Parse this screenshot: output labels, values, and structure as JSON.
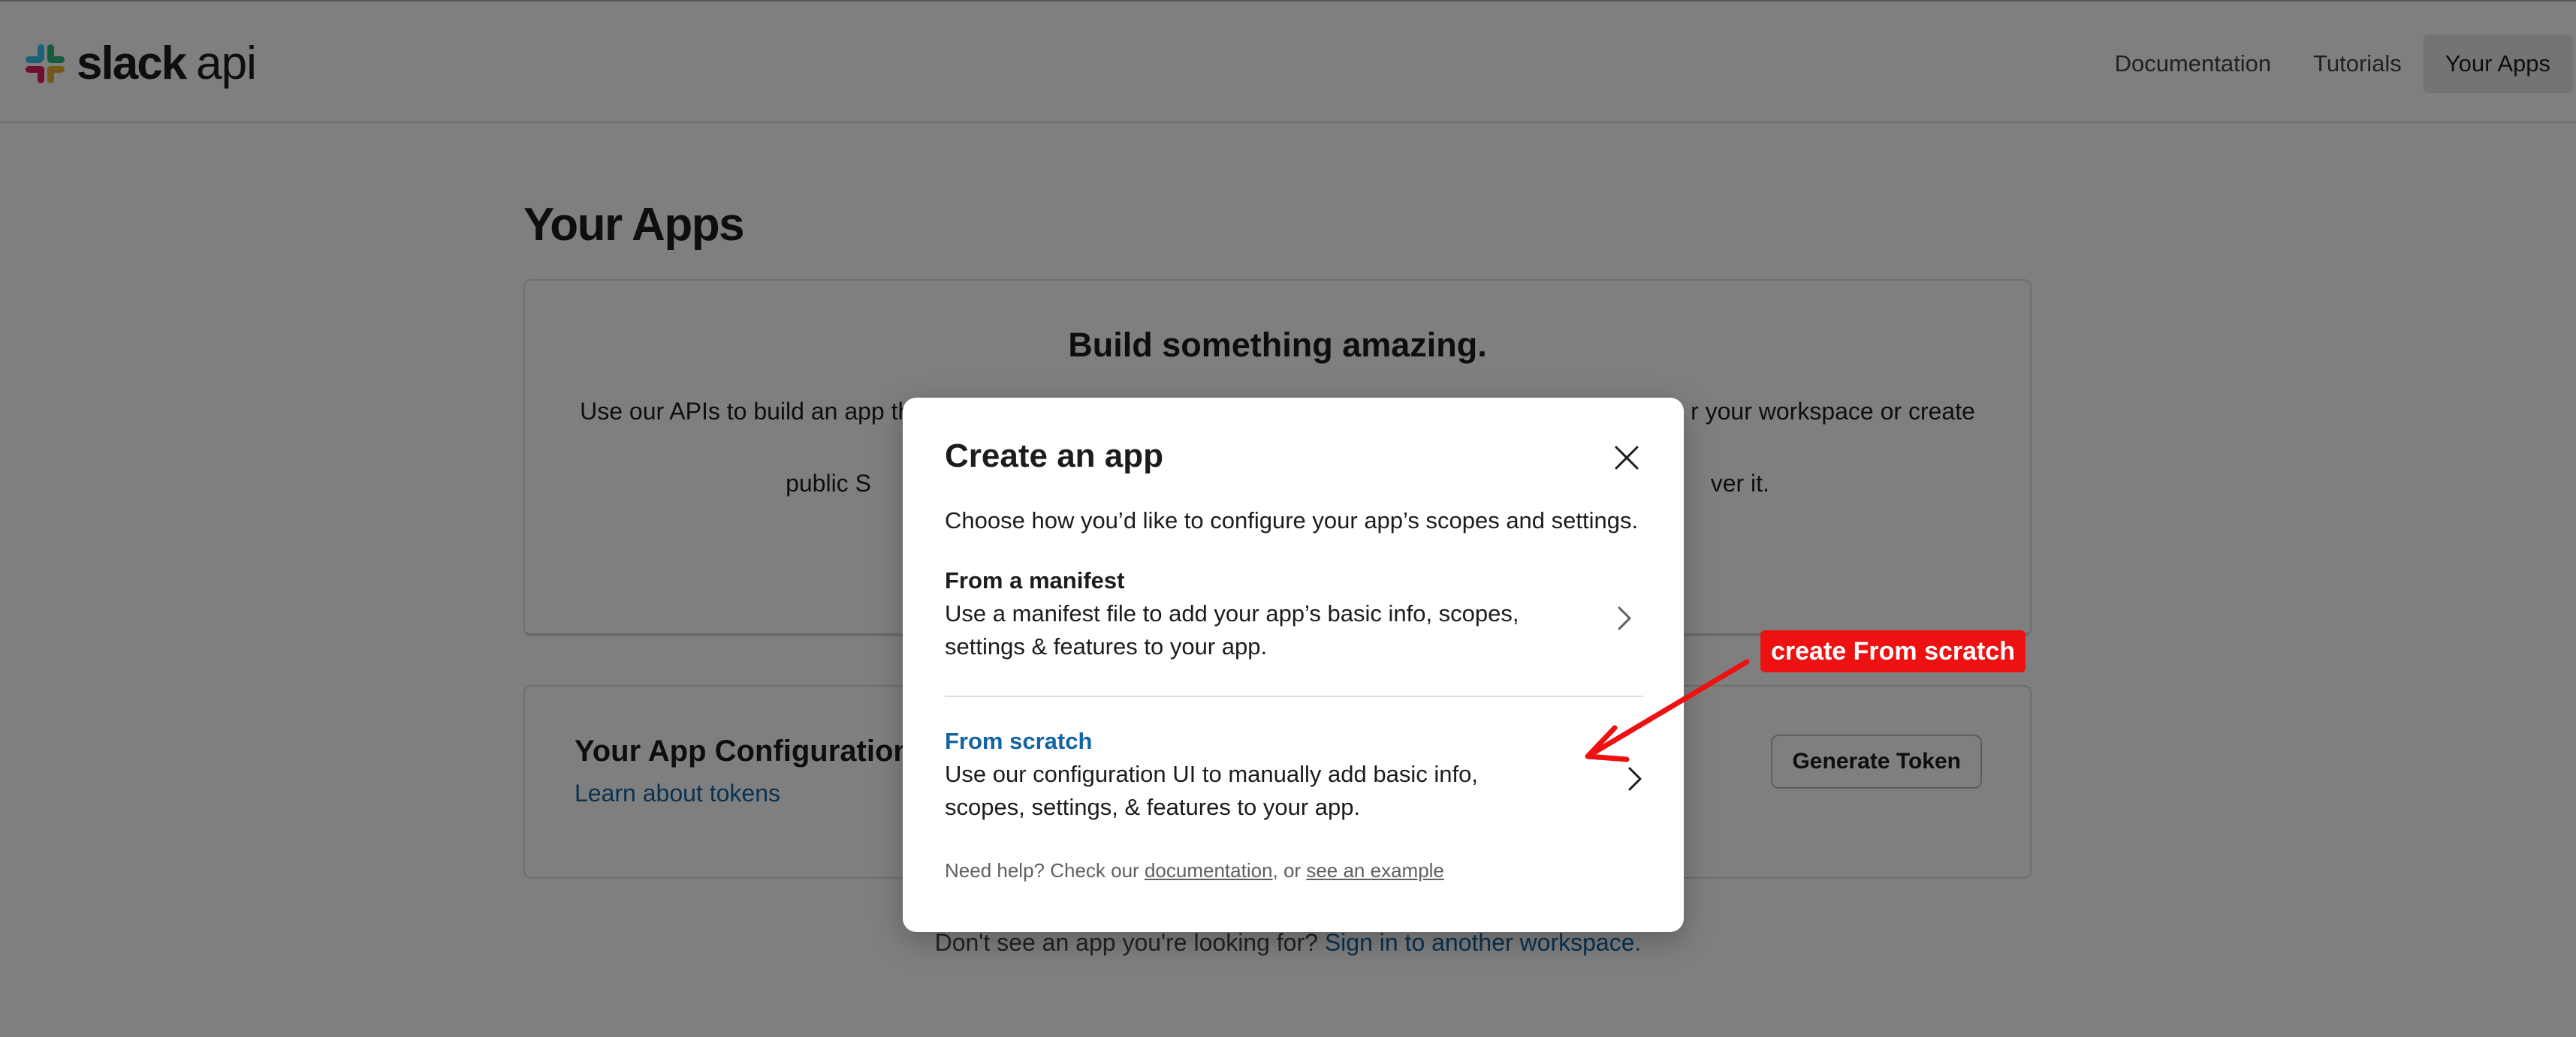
{
  "brand": {
    "name": "slack",
    "suffix": "api"
  },
  "nav": {
    "items": [
      {
        "label": "Documentation"
      },
      {
        "label": "Tutorials"
      },
      {
        "label": "Your Apps",
        "active": true
      }
    ]
  },
  "page": {
    "title": "Your Apps",
    "hero": {
      "title": "Build something amazing.",
      "text_left": "Use our APIs to build an app th",
      "text_right": "r your workspace or create a",
      "text_line2_left": "public S",
      "text_line2_right": "ver it."
    },
    "token_card": {
      "title": "Your App Configuration T",
      "link": "Learn about tokens",
      "button": "Generate Token"
    },
    "footer": {
      "text": "Don't see an app you're looking for?",
      "link": "Sign in to another workspace."
    }
  },
  "modal": {
    "title": "Create an app",
    "description": "Choose how you’d like to configure your app’s scopes and settings.",
    "options": [
      {
        "title": "From a manifest",
        "description": "Use a manifest file to add your app’s basic info, scopes, settings & features to your app."
      },
      {
        "title": "From scratch",
        "description": "Use our configuration UI to manually add basic info, scopes, settings, & features to your app."
      }
    ],
    "help": {
      "prefix": "Need help? Check our",
      "link1": "documentation",
      "middle": ", or",
      "link2": "see an example"
    }
  },
  "annotation": {
    "label": "create From scratch",
    "color": "#ee1111"
  },
  "colors": {
    "link": "#1264a3",
    "text": "#1d1c1d",
    "overlay": "rgba(0,0,0,0.5)"
  },
  "icons": {
    "logo": "slack-hash-logo",
    "close": "close-icon",
    "chevron": "chevron-right-icon"
  }
}
